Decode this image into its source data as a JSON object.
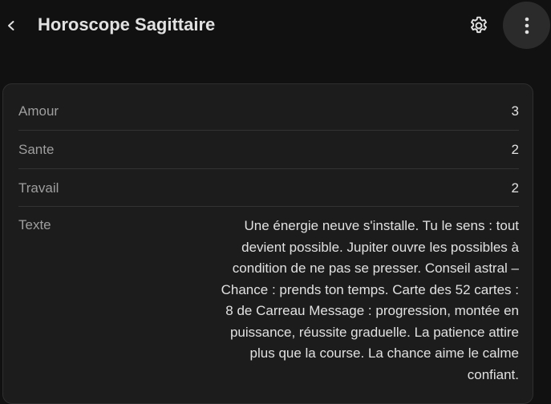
{
  "toolbar": {
    "title": "Horoscope Sagittaire",
    "icons": {
      "back": "chevron-left-icon",
      "settings": "gear-icon",
      "more": "more-vertical-icon"
    }
  },
  "card": {
    "rows": [
      {
        "label": "Amour",
        "value": "3"
      },
      {
        "label": "Sante",
        "value": "2"
      },
      {
        "label": "Travail",
        "value": "2"
      },
      {
        "label": "Texte",
        "value": "Une énergie neuve s'installe. Tu le sens : tout devient possible. Jupiter ouvre les possibles à condition de ne pas se presser. Conseil astral – Chance : prends ton temps. Carte des 52 cartes : 8 de Carreau Message : progression, montée en puissance, réussite graduelle. La patience attire plus que la course. La chance aime le calme confiant."
      }
    ]
  },
  "colors": {
    "background": "#111111",
    "card": "#1c1c1c",
    "label": "#9e9e9e",
    "text": "#e1e1e1",
    "divider": "#333333"
  }
}
